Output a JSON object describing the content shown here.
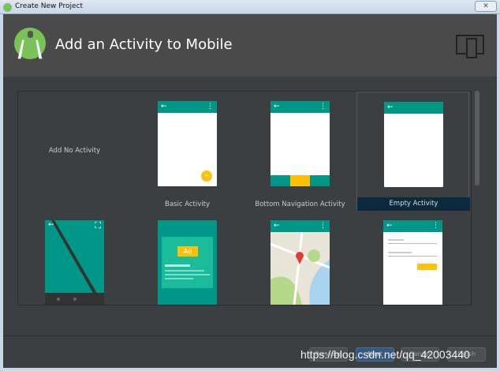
{
  "window": {
    "title": "Create New Project",
    "close": "✕"
  },
  "header": {
    "title": "Add an Activity to Mobile"
  },
  "templates": [
    {
      "label": "Add No Activity"
    },
    {
      "label": "Basic Activity"
    },
    {
      "label": "Bottom Navigation Activity"
    },
    {
      "label": "Empty Activity",
      "selected": true
    },
    {
      "label": ""
    },
    {
      "label": ""
    },
    {
      "label": ""
    },
    {
      "label": ""
    }
  ],
  "preview": {
    "back": "←",
    "menu": "⋮",
    "fab": "+",
    "ad": "Ad",
    "fullscreen": "⛶"
  },
  "buttons": {
    "previous": "Previous",
    "next": "Next",
    "cancel": "Cancel",
    "finish": "Finish"
  },
  "watermark": "https://blog.csdn.net/qq_42003440",
  "colors": {
    "primary": "#009688",
    "accent": "#ffc107",
    "selection": "#0d293e"
  }
}
